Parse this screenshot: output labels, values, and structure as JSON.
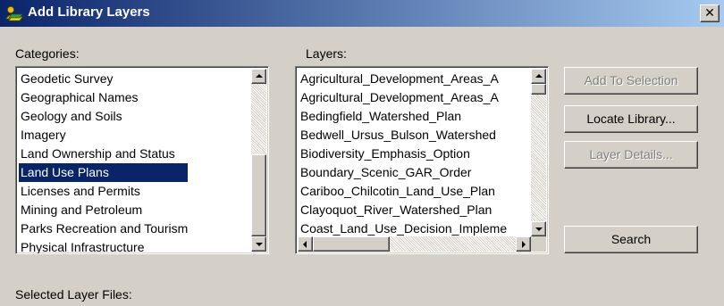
{
  "window": {
    "title": "Add Library Layers",
    "close_label": "✕"
  },
  "categories": {
    "label": "Categories:",
    "items": [
      "Geodetic Survey",
      "Geographical Names",
      "Geology and Soils",
      "Imagery",
      "Land Ownership and Status",
      "Land Use Plans",
      "Licenses and Permits",
      "Mining and Petroleum",
      "Parks Recreation and Tourism",
      "Physical Infrastructure"
    ],
    "selected": "Land Use Plans"
  },
  "layers": {
    "label": "Layers:",
    "items": [
      "Agricultural_Development_Areas_A",
      "Agricultural_Development_Areas_A",
      "Bedingfield_Watershed_Plan",
      "Bedwell_Ursus_Bulson_Watershed",
      "Biodiversity_Emphasis_Option",
      "Boundary_Scenic_GAR_Order",
      "Cariboo_Chilcotin_Land_Use_Plan",
      "Clayoquot_River_Watershed_Plan",
      "Coast_Land_Use_Decision_Impleme"
    ]
  },
  "buttons": {
    "add_to_selection": "Add To Selection",
    "locate_library": "Locate Library...",
    "layer_details": "Layer Details...",
    "search": "Search"
  },
  "selected_files": {
    "label": "Selected Layer Files:"
  },
  "colors": {
    "face": "#d4d0c8",
    "title_start": "#0a246a",
    "title_end": "#a6caf0",
    "selection": "#0a246a"
  }
}
